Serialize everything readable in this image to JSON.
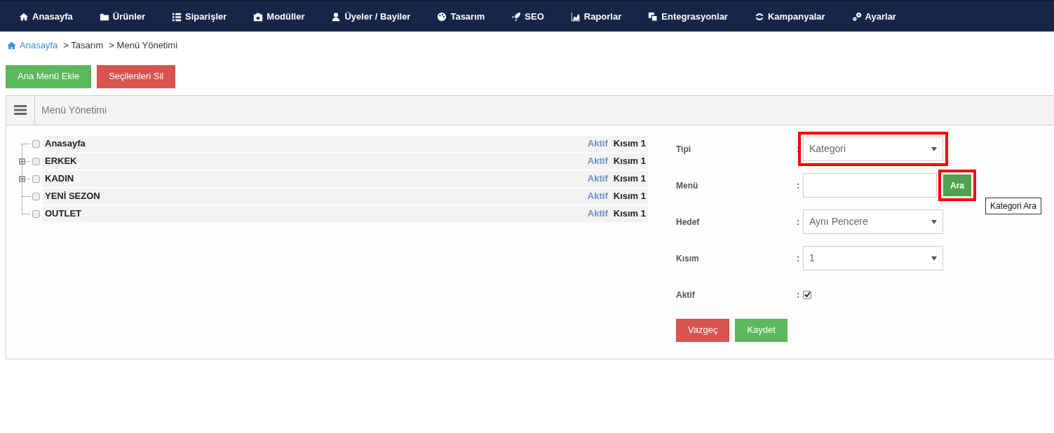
{
  "nav": [
    {
      "label": "Anasayfa"
    },
    {
      "label": "Ürünler"
    },
    {
      "label": "Siparişler"
    },
    {
      "label": "Modüller"
    },
    {
      "label": "Üyeler / Bayiler"
    },
    {
      "label": "Tasarım"
    },
    {
      "label": "SEO"
    },
    {
      "label": "Raporlar"
    },
    {
      "label": "Entegrasyonlar"
    },
    {
      "label": "Kampanyalar"
    },
    {
      "label": "Ayarlar"
    }
  ],
  "breadcrumb": {
    "home": "Anasayfa",
    "items": [
      "> Tasarım",
      "> Menü Yönetimi"
    ]
  },
  "actions": [
    {
      "label": "Ana Menü Ekle",
      "kind": "success"
    },
    {
      "label": "Seçilenleri Sil",
      "kind": "danger"
    }
  ],
  "panel": {
    "title": "Menü Yönetimi",
    "tree": [
      {
        "label": "Anasayfa",
        "checked": false,
        "expandable": false,
        "status": "Aktif",
        "section": "Kısım 1"
      },
      {
        "label": "ERKEK",
        "checked": false,
        "expandable": true,
        "status": "Aktif",
        "section": "Kısım 1"
      },
      {
        "label": "KADIN",
        "checked": false,
        "expandable": true,
        "status": "Aktif",
        "section": "Kısım 1"
      },
      {
        "label": "YENİ SEZON",
        "checked": false,
        "expandable": false,
        "status": "Aktif",
        "section": "Kısım 1"
      },
      {
        "label": "OUTLET",
        "checked": false,
        "expandable": false,
        "status": "Aktif",
        "section": "Kısım 1"
      }
    ],
    "form": [
      {
        "label": "Tipi",
        "separator": ":",
        "kind": "select",
        "value": "Kategori",
        "highlighted": true
      },
      {
        "label": "Menü",
        "separator": ":",
        "kind": "search",
        "button": "Ara",
        "tooltip": "Kategori Ara",
        "highlighted": true
      },
      {
        "label": "Hedef",
        "separator": ":",
        "kind": "select",
        "value": "Aynı Pencere",
        "highlighted": false
      },
      {
        "label": "Kısım",
        "separator": ":",
        "kind": "select",
        "value": "1",
        "highlighted": false
      },
      {
        "label": "Aktif",
        "separator": ":",
        "kind": "checkbox",
        "checked": true
      }
    ],
    "buttons": [
      {
        "label": "Vazgeç",
        "kind": "danger"
      },
      {
        "label": "Kaydet",
        "kind": "success"
      }
    ]
  }
}
